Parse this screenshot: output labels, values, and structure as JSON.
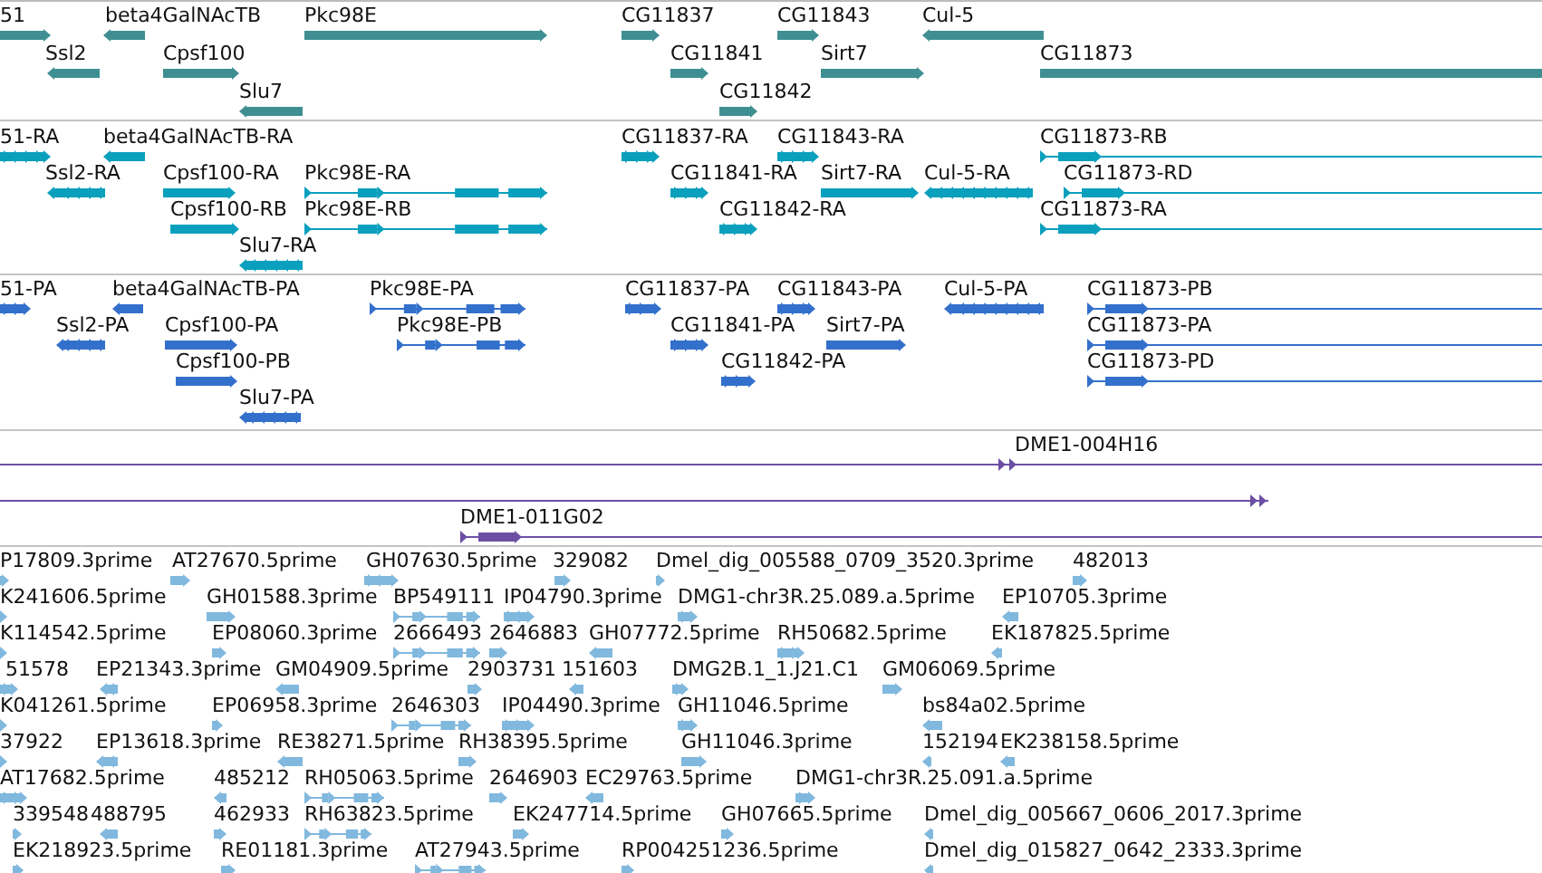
{
  "tracks": [
    {
      "kind": "gene",
      "features": [
        {
          "label": "51",
          "reverse": false
        },
        {
          "label": "beta4GalNAcTB",
          "reverse": true
        },
        {
          "label": "Pkc98E",
          "reverse": false
        },
        {
          "label": "CG11837",
          "reverse": false
        },
        {
          "label": "CG11843",
          "reverse": false
        },
        {
          "label": "Cul-5",
          "reverse": true
        },
        {
          "label": "Ssl2",
          "reverse": true
        },
        {
          "label": "Cpsf100",
          "reverse": false
        },
        {
          "label": "CG11841",
          "reverse": false
        },
        {
          "label": "Sirt7",
          "reverse": false
        },
        {
          "label": "CG11873"
        },
        {
          "label": "Slu7",
          "reverse": true
        },
        {
          "label": "CG11842",
          "reverse": false
        }
      ]
    },
    {
      "kind": "transcript",
      "features": [
        {
          "label": "51-RA",
          "reverse": false
        },
        {
          "label": "beta4GalNAcTB-RA",
          "reverse": true
        },
        {
          "label": "CG11837-RA",
          "reverse": false
        },
        {
          "label": "CG11843-RA",
          "reverse": false
        },
        {
          "label": "CG11873-RB",
          "reverse": false
        },
        {
          "label": "Ssl2-RA",
          "reverse": true
        },
        {
          "label": "Cpsf100-RA",
          "reverse": false
        },
        {
          "label": "Pkc98E-RA",
          "reverse": false
        },
        {
          "label": "CG11841-RA",
          "reverse": false
        },
        {
          "label": "Sirt7-RA",
          "reverse": false
        },
        {
          "label": "Cul-5-RA",
          "reverse": true
        },
        {
          "label": "CG11873-RD",
          "reverse": false
        },
        {
          "label": "Cpsf100-RB",
          "reverse": false
        },
        {
          "label": "Pkc98E-RB",
          "reverse": false
        },
        {
          "label": "CG11842-RA",
          "reverse": false
        },
        {
          "label": "CG11873-RA",
          "reverse": false
        },
        {
          "label": "Slu7-RA",
          "reverse": true
        }
      ]
    },
    {
      "kind": "protein",
      "features": [
        {
          "label": "51-PA",
          "reverse": false
        },
        {
          "label": "beta4GalNAcTB-PA",
          "reverse": true
        },
        {
          "label": "Pkc98E-PA",
          "reverse": false
        },
        {
          "label": "CG11837-PA",
          "reverse": false
        },
        {
          "label": "CG11843-PA",
          "reverse": false
        },
        {
          "label": "Cul-5-PA",
          "reverse": true
        },
        {
          "label": "CG11873-PB",
          "reverse": false
        },
        {
          "label": "Ssl2-PA",
          "reverse": true
        },
        {
          "label": "Cpsf100-PA",
          "reverse": false
        },
        {
          "label": "Pkc98E-PB",
          "reverse": false
        },
        {
          "label": "CG11841-PA",
          "reverse": false
        },
        {
          "label": "Sirt7-PA",
          "reverse": false
        },
        {
          "label": "CG11873-PA",
          "reverse": false
        },
        {
          "label": "Cpsf100-PB",
          "reverse": false
        },
        {
          "label": "CG11842-PA",
          "reverse": false
        },
        {
          "label": "CG11873-PD",
          "reverse": false
        },
        {
          "label": "Slu7-PA",
          "reverse": true
        }
      ]
    },
    {
      "kind": "clone",
      "features": [
        {
          "label": "DME1-004H16",
          "reverse": false
        },
        {
          "reverse": false
        },
        {
          "label": "DME1-011G02",
          "reverse": false
        }
      ]
    },
    {
      "kind": "est",
      "features": [
        {
          "label": "P17809.3prime",
          "reverse": false
        },
        {
          "label": "AT27670.5prime",
          "reverse": false
        },
        {
          "label": "GH07630.5prime",
          "reverse": false
        },
        {
          "label": "329082",
          "reverse": false
        },
        {
          "label": "Dmel_dig_005588_0709_3520.3prime",
          "reverse": false
        },
        {
          "label": "482013",
          "reverse": false
        },
        {
          "label": "K241606.5prime",
          "reverse": false
        },
        {
          "label": "GH01588.3prime",
          "reverse": false
        },
        {
          "label": "BP549111",
          "reverse": false
        },
        {
          "label": "IP04790.3prime",
          "reverse": false
        },
        {
          "label": "DMG1-chr3R.25.089.a.5prime",
          "reverse": false
        },
        {
          "label": "EP10705.3prime",
          "reverse": true
        },
        {
          "label": "K114542.5prime",
          "reverse": false
        },
        {
          "label": "EP08060.3prime",
          "reverse": false
        },
        {
          "label": "2666493",
          "reverse": false
        },
        {
          "label": "2646883",
          "reverse": false
        },
        {
          "label": "GH07772.5prime",
          "reverse": true
        },
        {
          "label": "RH50682.5prime",
          "reverse": false
        },
        {
          "label": "EK187825.5prime",
          "reverse": true
        },
        {
          "label": "51578",
          "reverse": false
        },
        {
          "label": "EP21343.3prime",
          "reverse": true
        },
        {
          "label": "GM04909.5prime",
          "reverse": true
        },
        {
          "label": "2903731",
          "reverse": false
        },
        {
          "label": "151603",
          "reverse": true
        },
        {
          "label": "DMG2B.1_1.J21.C1",
          "reverse": false
        },
        {
          "label": "GM06069.5prime",
          "reverse": false
        },
        {
          "label": "K041261.5prime",
          "reverse": false
        },
        {
          "label": "EP06958.3prime",
          "reverse": false
        },
        {
          "label": "2646303",
          "reverse": false
        },
        {
          "label": "IP04490.3prime",
          "reverse": false
        },
        {
          "label": "GH11046.5prime",
          "reverse": false
        },
        {
          "label": "bs84a02.5prime",
          "reverse": true
        },
        {
          "label": "37922",
          "reverse": false
        },
        {
          "label": "EP13618.3prime",
          "reverse": true
        },
        {
          "label": "RE38271.5prime",
          "reverse": true
        },
        {
          "label": "RH38395.5prime",
          "reverse": false
        },
        {
          "label": "GH11046.3prime",
          "reverse": false
        },
        {
          "label": "152194",
          "reverse": true
        },
        {
          "label": "EK238158.5prime",
          "reverse": true
        },
        {
          "label": "AT17682.5prime",
          "reverse": false
        },
        {
          "label": "485212",
          "reverse": true
        },
        {
          "label": "RH05063.5prime",
          "reverse": false
        },
        {
          "label": "2646903",
          "reverse": false
        },
        {
          "label": "EC29763.5prime",
          "reverse": true
        },
        {
          "label": "DMG1-chr3R.25.091.a.5prime",
          "reverse": false
        },
        {
          "label": "339548",
          "reverse": false
        },
        {
          "label": "488795",
          "reverse": true
        },
        {
          "label": "462933",
          "reverse": false
        },
        {
          "label": "RH63823.5prime",
          "reverse": false
        },
        {
          "label": "EK247714.5prime",
          "reverse": false
        },
        {
          "label": "GH07665.5prime",
          "reverse": false
        },
        {
          "label": "Dmel_dig_005667_0606_2017.3prime",
          "reverse": true
        },
        {
          "label": "EK218923.5prime",
          "reverse": false
        },
        {
          "label": "RE01181.3prime",
          "reverse": false
        },
        {
          "label": "AT27943.5prime",
          "reverse": false
        },
        {
          "label": "RP004251236.5prime",
          "reverse": false
        },
        {
          "label": "Dmel_dig_015827_0642_2333.3prime",
          "reverse": true
        }
      ]
    }
  ]
}
